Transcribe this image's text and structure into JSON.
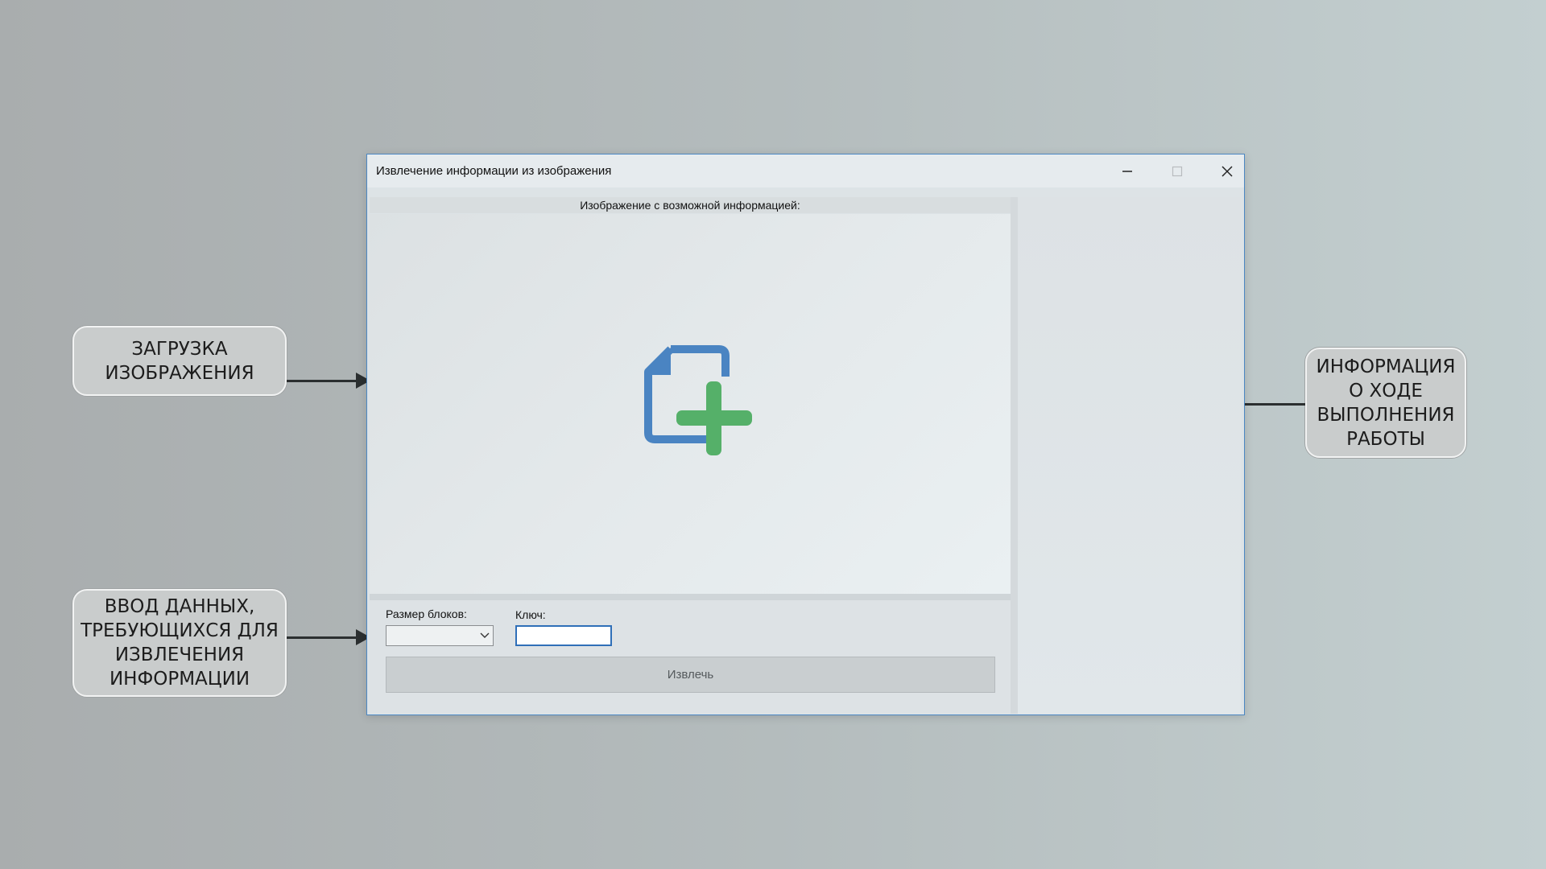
{
  "window": {
    "title": "Извлечение информации из изображения",
    "controls": {
      "minimize": "–",
      "maximize": "☐",
      "close": "✕"
    }
  },
  "image_panel": {
    "header": "Изображение с возможной информацией:",
    "icon": "add-file-icon"
  },
  "controls": {
    "block_size_label": "Размер блоков:",
    "block_size_value": "",
    "key_label": "Ключ:",
    "key_value": "",
    "extract_label": "Извлечь"
  },
  "log_panel": {
    "text": ""
  },
  "annotations": {
    "upload": "ЗАГРУЗКА ИЗОБРАЖЕНИЯ",
    "input": "ВВОД ДАННЫХ, ТРЕБУЮЩИХСЯ ДЛЯ ИЗВЛЕЧЕНИЯ ИНФОРМАЦИИ",
    "progress": "ИНФОРМАЦИЯ О ХОДЕ ВЫПОЛНЕНИЯ РАБОТЫ"
  },
  "colors": {
    "icon_blue": "#4a84c2",
    "icon_green": "#55b069",
    "accent_border": "#4b87c3"
  }
}
